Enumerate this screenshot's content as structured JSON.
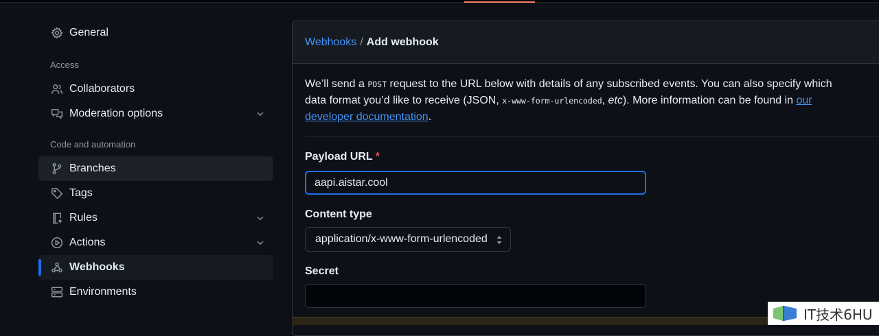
{
  "sidebar": {
    "general": "General",
    "access_label": "Access",
    "collaborators": "Collaborators",
    "moderation": "Moderation options",
    "code_label": "Code and automation",
    "branches": "Branches",
    "tags": "Tags",
    "rules": "Rules",
    "actions": "Actions",
    "webhooks": "Webhooks",
    "environments": "Environments"
  },
  "breadcrumb": {
    "parent": "Webhooks",
    "separator": "/",
    "current": "Add webhook"
  },
  "intro": {
    "p1": "We’ll send a ",
    "method": "POST",
    "p2": " request to the URL below with details of any subscribed events. You can also specify which data format you’d like to receive (JSON, ",
    "format": "x-www-form-urlencoded",
    "p3": ", ",
    "etc": "etc",
    "p4": "). More information can be found in ",
    "link": "our developer documentation",
    "p5": "."
  },
  "form": {
    "payload_label": "Payload URL",
    "required_mark": "*",
    "payload_value": "aapi.aistar.cool",
    "content_type_label": "Content type",
    "content_type_value": "application/x-www-form-urlencoded",
    "secret_label": "Secret",
    "secret_value": ""
  },
  "watermark": {
    "text": "IT技术6HU"
  },
  "colors": {
    "accent": "#1f6feb",
    "link": "#4493f8",
    "required": "#f85149",
    "background": "#0d1117"
  }
}
